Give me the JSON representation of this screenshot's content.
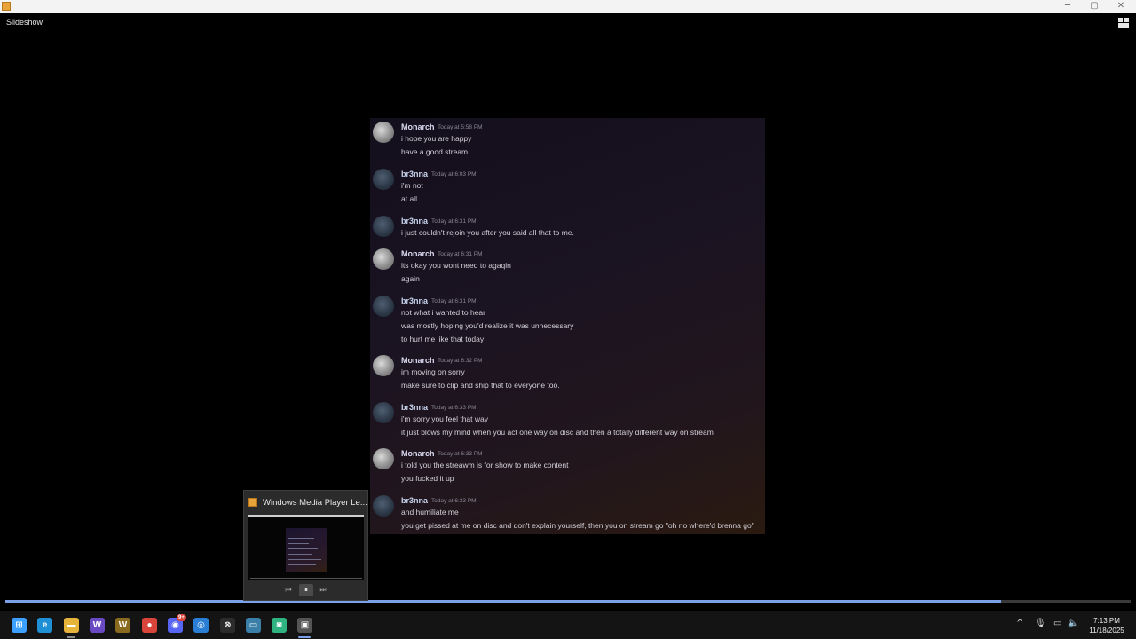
{
  "window": {
    "title_bar_controls": {
      "minimize": "─",
      "maximize": "▢",
      "close": "✕"
    }
  },
  "viewer": {
    "mode_label": "Slideshow",
    "seek_progress_fraction": 0.885
  },
  "chat": {
    "messages": [
      {
        "author": "Monarch",
        "timestamp": "Today at 5:58 PM",
        "lines": [
          "i hope you are happy",
          "have a good stream"
        ]
      },
      {
        "author": "br3nna",
        "timestamp": "Today at 6:03 PM",
        "lines": [
          "i'm not",
          "at all"
        ]
      },
      {
        "author": "br3nna",
        "timestamp": "Today at 6:31 PM",
        "lines": [
          "i just couldn't rejoin you after you said all that to me."
        ]
      },
      {
        "author": "Monarch",
        "timestamp": "Today at 6:31 PM",
        "lines": [
          "its okay you wont need to agaqin",
          "again"
        ]
      },
      {
        "author": "br3nna",
        "timestamp": "Today at 6:31 PM",
        "lines": [
          "not what i wanted to hear",
          "was mostly hoping you'd realize it was unnecessary",
          "to hurt me like that today"
        ]
      },
      {
        "author": "Monarch",
        "timestamp": "Today at 6:32 PM",
        "lines": [
          "im moving on sorry",
          "make sure to clip and ship that to everyone too."
        ]
      },
      {
        "author": "br3nna",
        "timestamp": "Today at 6:33 PM",
        "lines": [
          "i'm sorry you feel that way",
          "it just blows my mind when you act one way on disc and then a totally different way on stream"
        ]
      },
      {
        "author": "Monarch",
        "timestamp": "Today at 6:33 PM",
        "lines": [
          "i told you the streawm is for show to make content",
          "you fucked it up"
        ]
      },
      {
        "author": "br3nna",
        "timestamp": "Today at 6:33 PM",
        "lines": [
          "and humiliate me",
          "you get pissed at me on disc and don't explain yourself, then you on stream go \"oh no where'd brenna go\""
        ]
      }
    ]
  },
  "thumbnail": {
    "title": "Windows Media Player Le...",
    "prev_label": "⏮",
    "pause_label": "⏸",
    "next_label": "⏭"
  },
  "taskbar": {
    "apps": [
      {
        "name": "start-button",
        "glyph": "⊞",
        "color": "#3ba0ff"
      },
      {
        "name": "edge-app",
        "glyph": "e",
        "color": "#1f8fd6"
      },
      {
        "name": "file-explorer-app",
        "glyph": "▬",
        "color": "#e6b43a"
      },
      {
        "name": "word-app",
        "glyph": "W",
        "color": "#6a4ac2"
      },
      {
        "name": "wow-app",
        "glyph": "W",
        "color": "#8a6a1f"
      },
      {
        "name": "chrome-app",
        "glyph": "●",
        "color": "#d9453a"
      },
      {
        "name": "discord-app",
        "glyph": "◉",
        "color": "#5865f2"
      },
      {
        "name": "browser-app",
        "glyph": "◎",
        "color": "#2a7fd4"
      },
      {
        "name": "xbox-app",
        "glyph": "⊗",
        "color": "#2c2c2c"
      },
      {
        "name": "remote-app",
        "glyph": "▭",
        "color": "#3a7fa8"
      },
      {
        "name": "android-app",
        "glyph": "◙",
        "color": "#2fb380"
      },
      {
        "name": "media-player-app",
        "glyph": "▣",
        "color": "#555555"
      }
    ],
    "discord_badge": "9+",
    "tray": {
      "chevron": "^",
      "mic": "🎙",
      "display": "▭",
      "volume": "🔈"
    },
    "time": "7:13 PM",
    "date": "11/18/2025"
  }
}
